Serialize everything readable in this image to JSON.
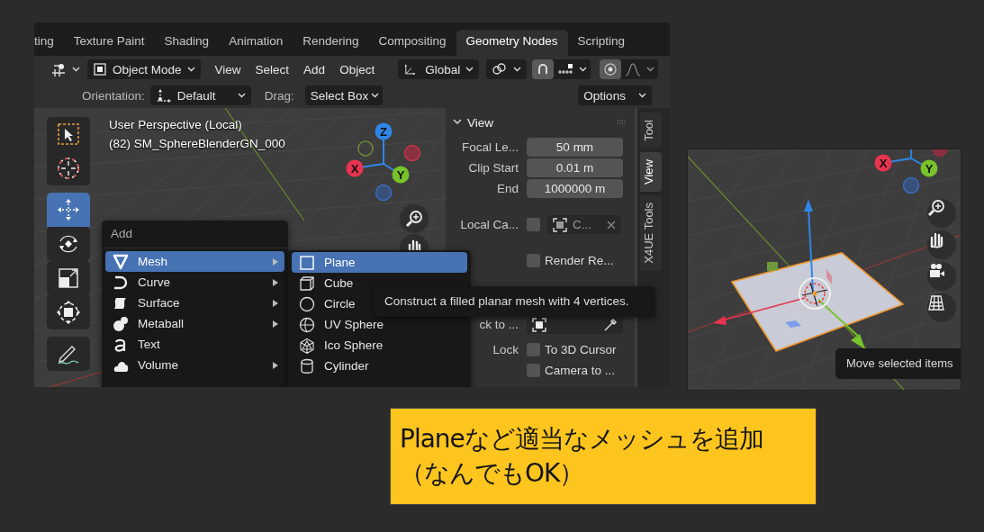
{
  "workspace_tabs": [
    {
      "label": "ting",
      "selected": false
    },
    {
      "label": "Texture Paint",
      "selected": false
    },
    {
      "label": "Shading",
      "selected": false
    },
    {
      "label": "Animation",
      "selected": false
    },
    {
      "label": "Rendering",
      "selected": false
    },
    {
      "label": "Compositing",
      "selected": false
    },
    {
      "label": "Geometry Nodes",
      "selected": true
    },
    {
      "label": "Scripting",
      "selected": false
    }
  ],
  "header": {
    "mode": "Object Mode",
    "menus": [
      "View",
      "Select",
      "Add",
      "Object"
    ],
    "transform_orientation": "Global",
    "snap": {
      "on": true
    },
    "proportional_editing": {
      "on": true
    }
  },
  "tool_settings": {
    "orientation_label": "Orientation:",
    "orientation": "Default",
    "drag_label": "Drag:",
    "drag": "Select Box",
    "options": "Options"
  },
  "viewport": {
    "title": "User Perspective (Local)",
    "object": "(82) SM_SphereBlenderGN_000",
    "gizmo_axes": [
      "Z",
      "X",
      "Y"
    ]
  },
  "toolbar": [
    {
      "kind": "select",
      "selected": false
    },
    {
      "kind": "cursor",
      "selected": false
    },
    {
      "kind": "move",
      "selected": true
    },
    {
      "kind": "rotate",
      "selected": false
    },
    {
      "kind": "scale",
      "selected": false
    },
    {
      "kind": "transform",
      "selected": false
    },
    {
      "kind": "annotate",
      "selected": false
    }
  ],
  "add_menu": {
    "title": "Add",
    "items": [
      {
        "kind": "mesh",
        "label": "Mesh",
        "selected": true,
        "submenu": true
      },
      {
        "kind": "curve",
        "label": "Curve",
        "selected": false,
        "submenu": true
      },
      {
        "kind": "surface",
        "label": "Surface",
        "selected": false,
        "submenu": true
      },
      {
        "kind": "metaball",
        "label": "Metaball",
        "selected": false,
        "submenu": true
      },
      {
        "kind": "text",
        "label": "Text",
        "selected": false,
        "submenu": false
      },
      {
        "kind": "volume",
        "label": "Volume",
        "selected": false,
        "submenu": true
      }
    ]
  },
  "mesh_menu": {
    "items": [
      {
        "kind": "plane",
        "label": "Plane",
        "selected": true
      },
      {
        "kind": "cube",
        "label": "Cube",
        "selected": false
      },
      {
        "kind": "circle",
        "label": "Circle",
        "selected": false
      },
      {
        "kind": "uv_sphere",
        "label": "UV Sphere",
        "selected": false
      },
      {
        "kind": "ico_sphere",
        "label": "Ico Sphere",
        "selected": false
      },
      {
        "kind": "cylinder",
        "label": "Cylinder",
        "selected": false
      }
    ]
  },
  "tooltip": "Construct a filled planar mesh with 4 vertices.",
  "sidebar": {
    "panel_title": "View",
    "rows": [
      {
        "kind": "number",
        "label": "Focal Le...",
        "value": "50 mm"
      },
      {
        "kind": "number",
        "label": "Clip Start",
        "value": "0.01 m"
      },
      {
        "kind": "number",
        "label": "End",
        "value": "1000000 m"
      },
      {
        "kind": "object",
        "label": "Local Ca...",
        "checked": false,
        "value": "C..."
      },
      {
        "kind": "checkbox",
        "text": "Render Re...",
        "checked": false
      },
      {
        "kind": "picker",
        "label": "ck to ..."
      },
      {
        "kind": "checkbox",
        "label": "Lock",
        "text": "To 3D Cursor",
        "checked": false
      },
      {
        "kind": "checkbox",
        "text": "Camera to ...",
        "checked": false
      }
    ],
    "tabs": [
      {
        "label": "Tool",
        "selected": false
      },
      {
        "label": "View",
        "selected": true
      },
      {
        "label": "X4UE Tools",
        "selected": false
      }
    ]
  },
  "preview": {
    "gizmo_axes": [
      "X",
      "Y"
    ],
    "tooltip": "Move selected items"
  },
  "note": {
    "lines": [
      "Planeなど適当なメッシュを追加",
      "（なんでもOK）"
    ]
  }
}
